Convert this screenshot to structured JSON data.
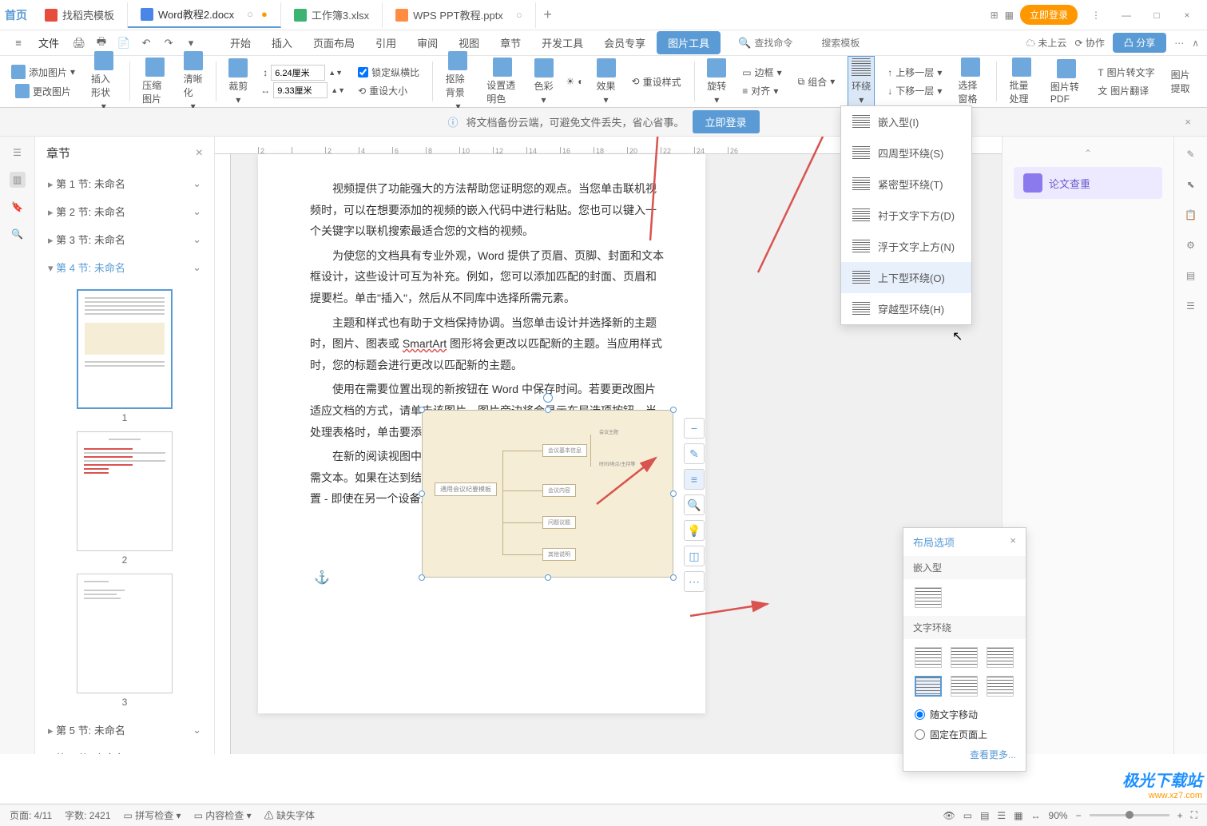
{
  "titlebar": {
    "home": "首页",
    "tabs": [
      {
        "icon": "doc",
        "label": "找稻壳模板"
      },
      {
        "icon": "word",
        "label": "Word教程2.docx",
        "active": true,
        "modified": true
      },
      {
        "icon": "excel",
        "label": "工作簿3.xlsx"
      },
      {
        "icon": "ppt",
        "label": "WPS PPT教程.pptx"
      }
    ],
    "login": "立即登录"
  },
  "menubar": {
    "file": "文件",
    "items": [
      "开始",
      "插入",
      "页面布局",
      "引用",
      "审阅",
      "视图",
      "章节",
      "开发工具",
      "会员专享"
    ],
    "active_tool": "图片工具",
    "search_cmd": "查找命令",
    "search_tpl": "搜索模板",
    "cloud": "未上云",
    "coop": "协作",
    "share": "分享"
  },
  "ribbon": {
    "add_image": "添加图片",
    "change_image": "更改图片",
    "insert_shape": "插入形状",
    "compress": "压缩图片",
    "cleanup": "清晰化",
    "crop": "裁剪",
    "dim_w": "6.24厘米",
    "dim_h": "9.33厘米",
    "lock_ratio": "锁定纵横比",
    "reset_size": "重设大小",
    "remove_bg": "抠除背景",
    "set_transparent": "设置透明色",
    "color": "色彩",
    "effect": "效果",
    "reset_style": "重设样式",
    "rotate": "旋转",
    "border": "边框",
    "combine": "组合",
    "align": "对齐",
    "wrap": "环绕",
    "move_up": "上移一层",
    "move_down": "下移一层",
    "select_pane": "选择窗格",
    "batch": "批量处理",
    "to_pdf": "图片转PDF",
    "to_text": "图片转文字",
    "translate": "图片翻译",
    "extract": "图片提取"
  },
  "infobar": {
    "text": "将文档备份云端，可避免文件丢失，省心省事。",
    "login": "立即登录"
  },
  "nav": {
    "title": "章节",
    "items": [
      {
        "label": "第 1 节: 未命名"
      },
      {
        "label": "第 2 节: 未命名"
      },
      {
        "label": "第 3 节: 未命名"
      },
      {
        "label": "第 4 节: 未命名",
        "active": true
      },
      {
        "label": "第 5 节: 未命名"
      },
      {
        "label": "第 6 节: 未命名"
      }
    ],
    "thumbs": [
      "1",
      "2",
      "3"
    ]
  },
  "ruler": [
    "2",
    "",
    "2",
    "4",
    "6",
    "8",
    "10",
    "12",
    "14",
    "16",
    "18",
    "20",
    "22",
    "24",
    "26"
  ],
  "document": {
    "p1": "视频提供了功能强大的方法帮助您证明您的观点。当您单击联机视频时，可以在想要添加的视频的嵌入代码中进行粘贴。您也可以键入一个关键字以联机搜索最适合您的文档的视频。",
    "p2a": "为使您的文档具有专业外观，Word 提供了页眉、页脚、封面和文本框设计，这些设计可互为补充。例如，您可以添加匹配的封面、页眉和提要栏。单击\"插入\"，然后从不同库中选择所需元素。",
    "p3a": "主题和样式也有助于文档保持协调。当您单击设计并选择新的主题时，图片、图表或 ",
    "p3b": "SmartArt",
    "p3c": " 图形将会更改以匹配新的主题。当应用样式时，您的标题会进行更改以匹配新的主题。",
    "p4": "使用在需要位置出现的新按钮在 Word 中保存时间。若要更改图片适应文档的方式，请单击该图片，图片旁边将会显示布局选项按钮。当处理表格时，单击要添加行或列的位置，然后单击加号。",
    "p5": "在新的阅读视图中阅读更加容易。可以折叠文档某些部分并关注所需文本。如果在达到结尾处之前需要停止读取，Word 会记住您的停止位置 - 即使在另一个设备上。",
    "diagram_center": "通用会议纪要模板"
  },
  "wrap_menu": {
    "items": [
      {
        "label": "嵌入型(I)"
      },
      {
        "label": "四周型环绕(S)"
      },
      {
        "label": "紧密型环绕(T)"
      },
      {
        "label": "衬于文字下方(D)"
      },
      {
        "label": "浮于文字上方(N)"
      },
      {
        "label": "上下型环绕(O)",
        "hover": true
      },
      {
        "label": "穿越型环绕(H)"
      }
    ]
  },
  "layout_popup": {
    "title": "布局选项",
    "section1": "嵌入型",
    "section2": "文字环绕",
    "radio1": "随文字移动",
    "radio2": "固定在页面上",
    "more": "查看更多..."
  },
  "right_panel": {
    "paper_check": "论文查重"
  },
  "statusbar": {
    "page": "页面: 4/11",
    "words": "字数: 2421",
    "spell": "拼写检查",
    "content": "内容检查",
    "font": "缺失字体",
    "zoom": "90%"
  },
  "watermark": {
    "top": "极光下载站",
    "bot": "www.xz7.com"
  }
}
